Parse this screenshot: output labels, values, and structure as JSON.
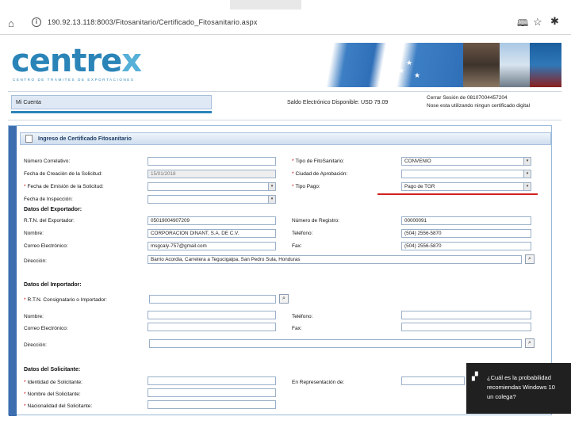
{
  "browser": {
    "url": "190.92.13.118:8003/Fitosanitario/Certificado_Fitosanitario.aspx",
    "home_glyph": "⌂",
    "info_glyph": "i",
    "reading_glyph": "🕮",
    "star_glyph": "☆",
    "hub_glyph": "✱"
  },
  "banner": {
    "logo_main": "centre",
    "logo_x": "x",
    "logo_sub": "CENTRO DE TRÁMITES DE EXPORTACIONES"
  },
  "account": {
    "mi_cuenta": "Mi Cuenta",
    "saldo": "Saldo Electrónico Disponible: USD 79.09",
    "session_line1": "Cerrar Sesión de 08107004457204",
    "session_line2": "Nose esta utilizando ningun certificado digital"
  },
  "form": {
    "title": "Ingreso de Certificado Fitosanitario",
    "labels": {
      "numero_correlativo": "Número Correlativo:",
      "fecha_creacion": "Fecha de Creación de la Solicitud:",
      "fecha_emision": "Fecha de Emisión de la Solicitud:",
      "fecha_inspeccion": "Fecha de Inspección:",
      "tipo_fito": "Tipo de FitoSanitario:",
      "ciudad_aprobacion": "Ciudad de Aprobación:",
      "tipo_pago": "Tipo Pago:",
      "datos_exportador": "Datos del Exportador:",
      "rtn_exportador": "R.T.N. del Exportador:",
      "nombre": "Nombre:",
      "correo": "Correo Electrónico:",
      "direccion": "Dirección:",
      "numero_registro": "Número de Registro:",
      "telefono": "Teléfono:",
      "fax": "Fax:",
      "datos_importador": "Datos del Importador:",
      "rtn_importador": "R.T.N. Consignatario o Importador:",
      "imp_nombre": "Nombre:",
      "imp_correo": "Correo Electrónico:",
      "imp_direccion": "Dirección:",
      "imp_telefono": "Teléfono:",
      "imp_fax": "Fax:",
      "datos_solicitante": "Datos del Solicitante:",
      "identidad_solicitante": "Identidad de Solicitante:",
      "nombre_solicitante": "Nombre del Solicitante:",
      "nacionalidad_solicitante": "Nacionalidad del Solicitante:",
      "en_representacion": "En Representación de:"
    },
    "values": {
      "fecha_creacion": "15/01/2018",
      "tipo_fito": "CONVENIO",
      "tipo_pago": "Pago de TGR",
      "rtn_exportador": "05019004907209",
      "nombre": "CORPORACION DINANT, S.A. DE C.V.",
      "correo": "msgcaly-757@gmail.com",
      "direccion": "Barrio Acordia, Carretera a Tegucigalpa, San Pedro Sula, Honduras",
      "numero_registro": "00000091",
      "telefono": "(504) 2556-5870",
      "fax": "(504) 2556-5870"
    },
    "required_mark": "*",
    "select_arrow": "▾",
    "search_glyph": "⌕"
  },
  "toast": {
    "icon": "▞",
    "line1": "¿Cuál es la probabilidad",
    "line2": "recomiendas Windows 10",
    "line3": "un colega?"
  }
}
